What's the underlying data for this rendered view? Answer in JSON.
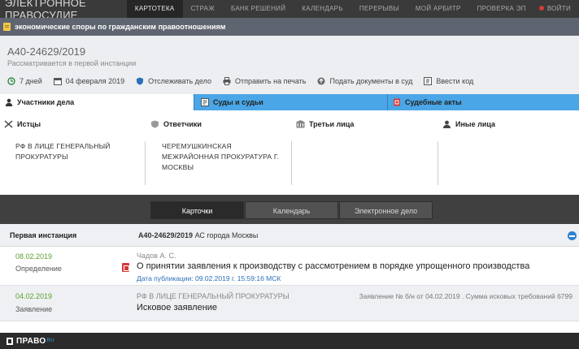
{
  "nav": {
    "brand": "ЭЛЕКТРОННОЕ ПРАВОСУДИЕ",
    "items": [
      "КАРТОТЕКА",
      "СТРАЖ",
      "БАНК РЕШЕНИЙ",
      "КАЛЕНДАРЬ",
      "ПЕРЕРЫВЫ",
      "МОЙ АРБИТР",
      "ПРОВЕРКА ЭП"
    ],
    "logout": "ВОЙТИ"
  },
  "category": "экономические споры по гражданским правоотношениям",
  "case": {
    "number": "А40-24629/2019",
    "status": "Рассматривается в первой инстанции"
  },
  "toolbar": {
    "days": "7 дней",
    "date": "04 февраля 2019",
    "track": "Отслеживать дело",
    "print": "Отправить на печать",
    "submit": "Подать документы в суд",
    "code": "Ввести код"
  },
  "tabs": [
    "Участники дела",
    "Суды и судьи",
    "Судебные акты"
  ],
  "parties": {
    "plaintiffs": {
      "label": "Истцы",
      "value_lines": [
        "РФ В ЛИЦЕ ГЕНЕРАЛЬНЫЙ",
        "ПРОКУРАТУРЫ"
      ]
    },
    "defendants": {
      "label": "Ответчики",
      "value_lines": [
        "ЧЕРЕМУШКИНСКАЯ",
        "МЕЖРАЙОННАЯ ПРОКУРАТУРА Г.",
        "МОСКВЫ"
      ]
    },
    "third": {
      "label": "Третьи лица"
    },
    "other": {
      "label": "Иные лица"
    }
  },
  "bottom_tabs": [
    "Карточки",
    "Календарь",
    "Электронное дело"
  ],
  "instance": {
    "label": "Первая инстанция",
    "case_no": "А40-24629/2019",
    "court": "АС города Москвы"
  },
  "events": [
    {
      "date": "08.02.2019",
      "type": "Определение",
      "who": "Чадов А. С.",
      "title": "О принятии заявления к производству с рассмотрением в порядке упрощенного производства",
      "published": "Дата публикации: 09.02.2019 г. 15:59:16 МСК"
    },
    {
      "date": "04.02.2019",
      "type": "Заявление",
      "who": "РФ В ЛИЦЕ ГЕНЕРАЛЬНЫЙ ПРОКУРАТУРЫ",
      "title": "Исковое заявление",
      "right": "Заявление № б/н от 04.02.2019 . Сумма исковых требований 6799"
    }
  ],
  "footer": {
    "logo": "ПРАВО",
    "logo_sup": "RU"
  }
}
